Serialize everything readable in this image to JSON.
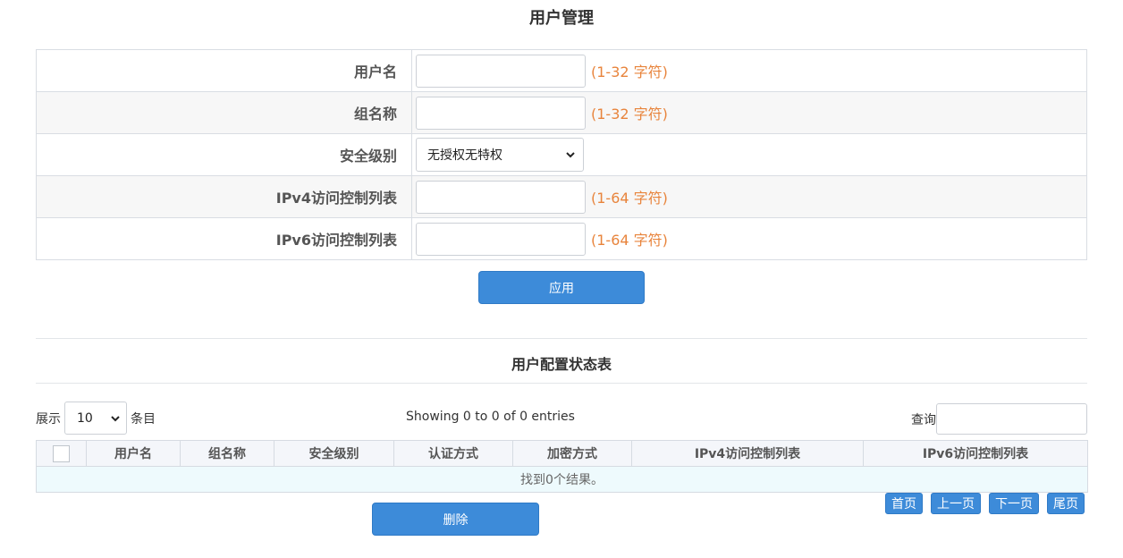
{
  "page_title": "用户管理",
  "form": {
    "username": {
      "label": "用户名",
      "value": "",
      "hint": "(1-32 字符)"
    },
    "group": {
      "label": "组名称",
      "value": "",
      "hint": "(1-32 字符)"
    },
    "security": {
      "label": "安全级别",
      "selected": "无授权无特权"
    },
    "ipv4_acl": {
      "label": "IPv4访问控制列表",
      "value": "",
      "hint": "(1-64 字符)"
    },
    "ipv6_acl": {
      "label": "IPv6访问控制列表",
      "value": "",
      "hint": "(1-64 字符)"
    }
  },
  "apply_label": "应用",
  "section_title": "用户配置状态表",
  "table_controls": {
    "show_label": "展示",
    "page_length": "10",
    "entries_label": "条目",
    "info": "Showing 0 to 0 of 0 entries",
    "search_label": "查询",
    "search_value": ""
  },
  "table": {
    "columns": [
      "用户名",
      "组名称",
      "安全级别",
      "认证方式",
      "加密方式",
      "IPv4访问控制列表",
      "IPv6访问控制列表"
    ],
    "empty_message": "找到0个结果。"
  },
  "pagination": {
    "first": "首页",
    "prev": "上一页",
    "next": "下一页",
    "last": "尾页"
  },
  "delete_label": "删除",
  "colors": {
    "primary": "#3d8bd9",
    "hint": "#e8843c"
  },
  "icons": {
    "select_arrow": "chevron-down-icon"
  }
}
